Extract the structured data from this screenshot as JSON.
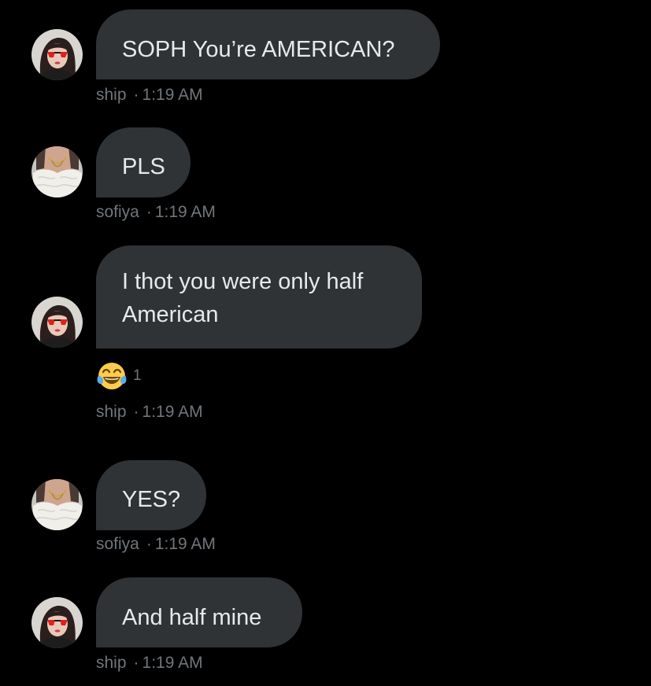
{
  "colors": {
    "background": "#000000",
    "bubble": "#2f3336",
    "text": "#e7e9ea",
    "meta": "#71767b"
  },
  "messages": [
    {
      "sender": "ship",
      "avatar": "avatar-ship",
      "text": "SOPH You’re AMERICAN?",
      "time": "1:19 AM"
    },
    {
      "sender": "sofiya",
      "avatar": "avatar-sofiya",
      "text": "PLS",
      "time": "1:19 AM"
    },
    {
      "sender": "ship",
      "avatar": "avatar-ship",
      "text": "I thot you were only half\nAmerican",
      "time": "1:19 AM",
      "reaction": {
        "icon": "face-with-tears-of-joy-emoji",
        "count": "1"
      }
    },
    {
      "sender": "sofiya",
      "avatar": "avatar-sofiya",
      "text": "YES?",
      "time": "1:19 AM"
    },
    {
      "sender": "ship",
      "avatar": "avatar-ship",
      "text": "And half mine",
      "time": "1:19 AM"
    }
  ],
  "separator": "·"
}
